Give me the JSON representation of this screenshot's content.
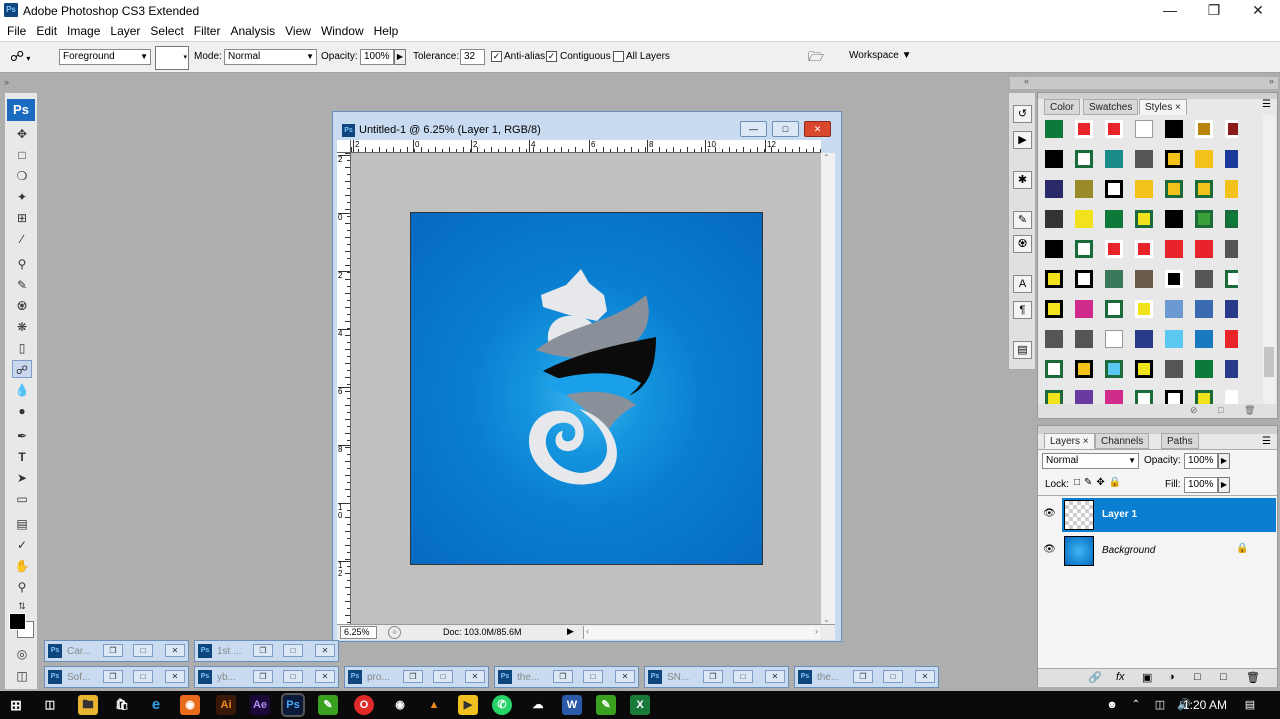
{
  "app": {
    "title": "Adobe Photoshop CS3 Extended",
    "logo": "Ps"
  },
  "menu": [
    "File",
    "Edit",
    "Image",
    "Layer",
    "Select",
    "Filter",
    "Analysis",
    "View",
    "Window",
    "Help"
  ],
  "options": {
    "fill_source": "Foreground",
    "mode_label": "Mode:",
    "mode_value": "Normal",
    "opacity_label": "Opacity:",
    "opacity_value": "100%",
    "tolerance_label": "Tolerance:",
    "tolerance_value": "32",
    "antialias_label": "Anti-alias",
    "antialias_checked": true,
    "contiguous_label": "Contiguous",
    "contiguous_checked": true,
    "alllayers_label": "All Layers",
    "alllayers_checked": false,
    "workspace_label": "Workspace ▼"
  },
  "document": {
    "title": "Untitled-1 @ 6.25% (Layer 1, RGB/8)",
    "zoom": "6.25%",
    "doc_info": "Doc: 103.0M/85.6M",
    "h_ticks": [
      "2",
      "0",
      "2",
      "4",
      "6",
      "8",
      "10",
      "12"
    ],
    "v_ticks": [
      "2",
      "0",
      "2",
      "4",
      "6",
      "8",
      "1\n0",
      "1\n2"
    ]
  },
  "styles_panel": {
    "tabs": [
      "Color",
      "Swatches",
      "Styles"
    ],
    "active_tab": "Styles"
  },
  "layers_panel": {
    "tabs": [
      "Layers",
      "Channels",
      "Paths"
    ],
    "blend_mode": "Normal",
    "opacity_label": "Opacity:",
    "opacity_value": "100%",
    "lock_label": "Lock:",
    "fill_label": "Fill:",
    "fill_value": "100%",
    "layers": [
      {
        "name": "Layer 1",
        "selected": true
      },
      {
        "name": "Background",
        "locked": true
      }
    ]
  },
  "minimized_docs": [
    "Car...",
    "1st ...",
    "Sof...",
    "yb...",
    "pro...",
    "the...",
    "SN...",
    "the..."
  ],
  "taskbar": {
    "time": "1:20 AM"
  },
  "colors": {
    "selection": "#0a7fd2",
    "accent": "#1b6bc0",
    "artwork_bg": "#0a7fd2"
  }
}
